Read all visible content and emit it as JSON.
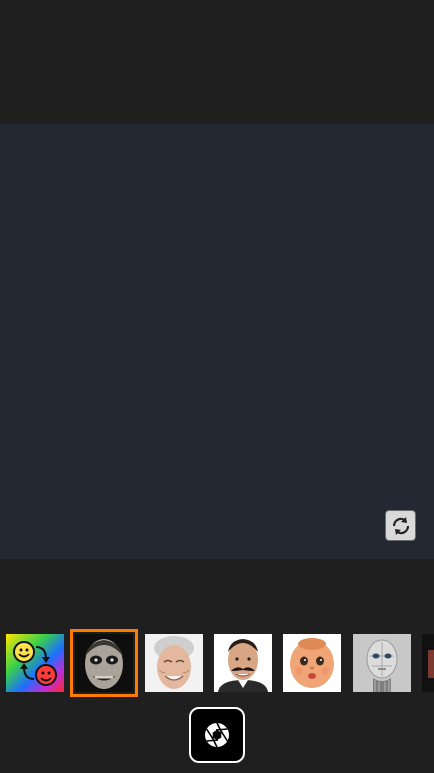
{
  "icons": {
    "switch_camera": "camera-switch-icon",
    "shutter": "aperture-icon",
    "face_swap": "face-swap-icon"
  },
  "colors": {
    "selection_outline": "#ff7a00",
    "preview_background": "#232833",
    "app_background": "#1f1f1f"
  },
  "filters": [
    {
      "name": "face-swap",
      "selected": false
    },
    {
      "name": "zombie",
      "selected": true
    },
    {
      "name": "old-woman",
      "selected": false
    },
    {
      "name": "mustache-man",
      "selected": false
    },
    {
      "name": "baby-doll",
      "selected": false
    },
    {
      "name": "robot",
      "selected": false
    },
    {
      "name": "extra",
      "selected": false
    }
  ]
}
